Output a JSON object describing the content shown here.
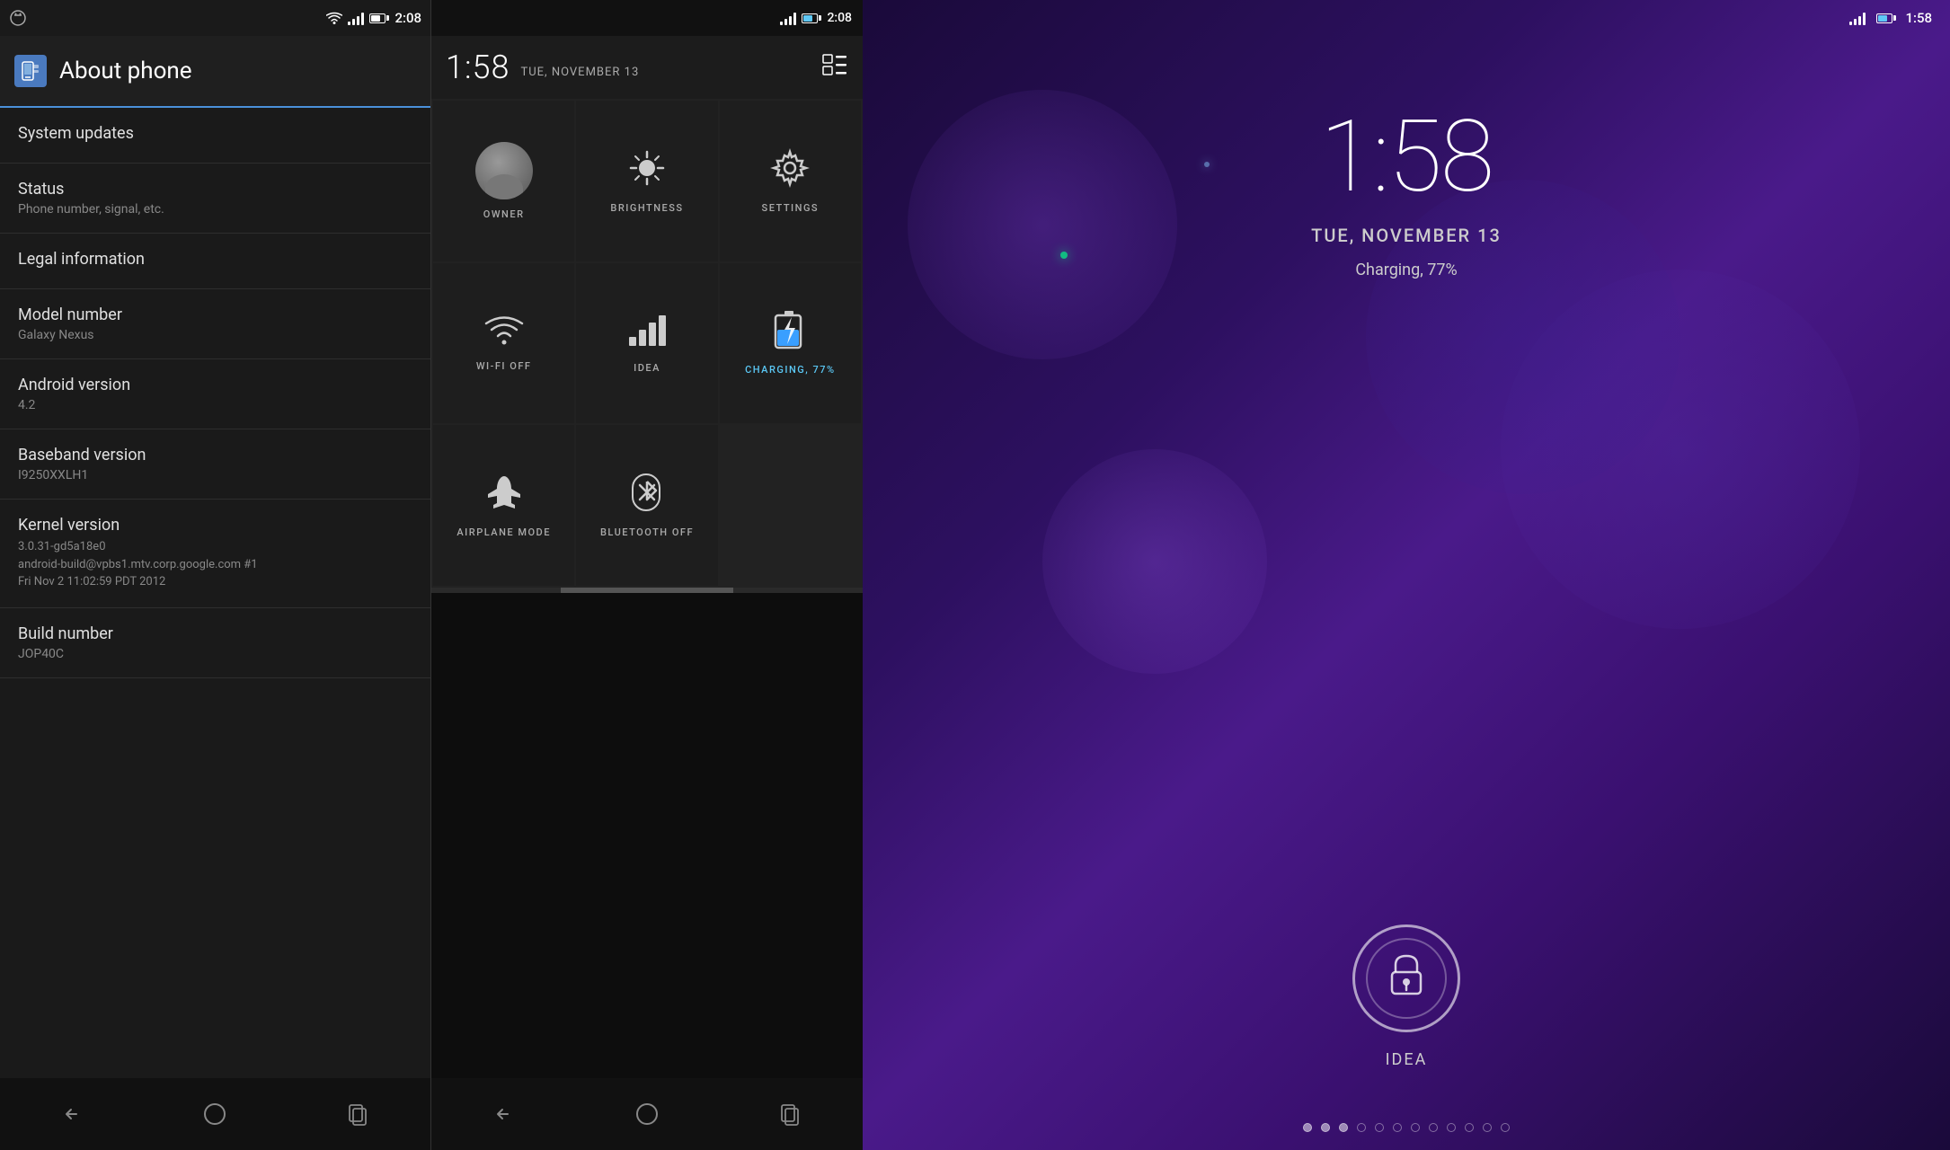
{
  "panel1": {
    "statusBar": {
      "time": "2:08"
    },
    "header": {
      "title": "About phone",
      "iconLabel": "about-phone-icon"
    },
    "items": [
      {
        "id": "system-updates",
        "title": "System updates",
        "subtitle": ""
      },
      {
        "id": "status",
        "title": "Status",
        "subtitle": "Phone number, signal, etc."
      },
      {
        "id": "legal-information",
        "title": "Legal information",
        "subtitle": ""
      },
      {
        "id": "model-number",
        "title": "Model number",
        "subtitle": "Galaxy Nexus"
      },
      {
        "id": "android-version",
        "title": "Android version",
        "subtitle": "4.2"
      },
      {
        "id": "baseband-version",
        "title": "Baseband version",
        "subtitle": "I9250XXLH1"
      },
      {
        "id": "kernel-version",
        "title": "Kernel version",
        "subtitle": "3.0.31-gd5a18e0\nandroid-build@vpbs1.mtv.corp.google.com #1\nFri Nov 2 11:02:59 PDT 2012"
      },
      {
        "id": "build-number",
        "title": "Build number",
        "subtitle": "JOP40C"
      }
    ],
    "nav": {
      "back": "◁",
      "home": "○",
      "recent": "□"
    }
  },
  "panel2": {
    "statusBar": {
      "time": "2:08"
    },
    "header": {
      "time": "1:58",
      "date": "TUE, NOVEMBER 13"
    },
    "tiles": [
      {
        "id": "owner",
        "label": "OWNER",
        "icon": "owner"
      },
      {
        "id": "brightness",
        "label": "BRIGHTNESS",
        "icon": "brightness"
      },
      {
        "id": "settings",
        "label": "SETTINGS",
        "icon": "settings"
      },
      {
        "id": "wifi",
        "label": "WI-FI OFF",
        "icon": "wifi"
      },
      {
        "id": "idea",
        "label": "IDEA",
        "icon": "signal"
      },
      {
        "id": "charging",
        "label": "CHARGING, 77%",
        "icon": "battery"
      },
      {
        "id": "airplane",
        "label": "AIRPLANE MODE",
        "icon": "airplane"
      },
      {
        "id": "bluetooth",
        "label": "BLUETOOTH OFF",
        "icon": "bluetooth"
      }
    ],
    "nav": {
      "back": "◁",
      "home": "○",
      "recent": "□"
    }
  },
  "panel3": {
    "statusBar": {
      "time": "1:58"
    },
    "time": "1:58",
    "date": "TUE, NOVEMBER 13",
    "charging": "Charging, 77%",
    "carrier": "IDEA",
    "lockHint": "lock-icon"
  }
}
